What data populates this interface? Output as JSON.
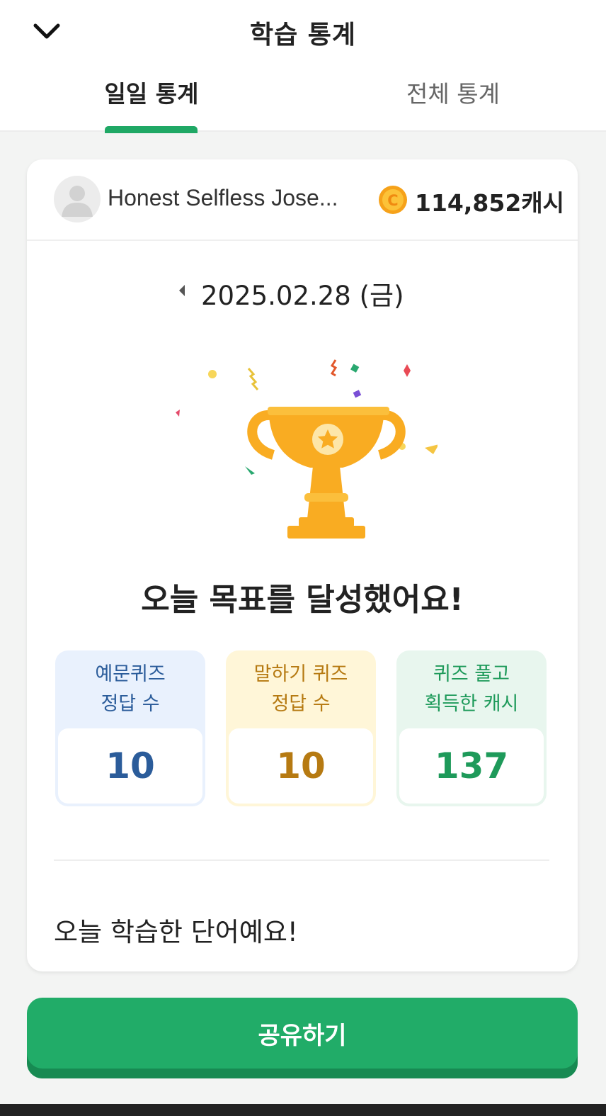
{
  "header": {
    "back_icon": "chevron-down-icon",
    "title": "학습 통계"
  },
  "tabs": [
    {
      "label": "일일 통계",
      "active": true
    },
    {
      "label": "전체 통계",
      "active": false
    }
  ],
  "profile": {
    "name": "Honest Selfless Jose...",
    "coin_icon": "coin-icon",
    "cash": "114,852캐시"
  },
  "date": {
    "prev_icon": "caret-left-icon",
    "text": "2025.02.28 (금)"
  },
  "goal_message": "오늘 목표를 달성했어요!",
  "stats": [
    {
      "label_line1": "예문퀴즈",
      "label_line2": "정답 수",
      "value": "10",
      "color": "#2b5c9a"
    },
    {
      "label_line1": "말하기 퀴즈",
      "label_line2": "정답 수",
      "value": "10",
      "color": "#b67a12"
    },
    {
      "label_line1": "퀴즈 풀고",
      "label_line2": "획득한 캐시",
      "value": "137",
      "color": "#1e9a5a"
    }
  ],
  "words_title": "오늘 학습한 단어예요!",
  "share_button": "공유하기",
  "colors": {
    "accent": "#21ac68",
    "trophy": "#f9ac22"
  }
}
